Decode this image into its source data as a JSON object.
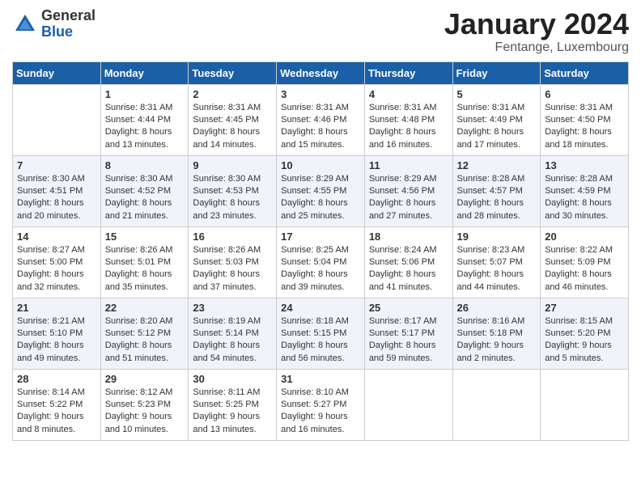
{
  "header": {
    "logo_general": "General",
    "logo_blue": "Blue",
    "month_title": "January 2024",
    "location": "Fentange, Luxembourg"
  },
  "days_of_week": [
    "Sunday",
    "Monday",
    "Tuesday",
    "Wednesday",
    "Thursday",
    "Friday",
    "Saturday"
  ],
  "weeks": [
    [
      {
        "day": "",
        "info": ""
      },
      {
        "day": "1",
        "info": "Sunrise: 8:31 AM\nSunset: 4:44 PM\nDaylight: 8 hours\nand 13 minutes."
      },
      {
        "day": "2",
        "info": "Sunrise: 8:31 AM\nSunset: 4:45 PM\nDaylight: 8 hours\nand 14 minutes."
      },
      {
        "day": "3",
        "info": "Sunrise: 8:31 AM\nSunset: 4:46 PM\nDaylight: 8 hours\nand 15 minutes."
      },
      {
        "day": "4",
        "info": "Sunrise: 8:31 AM\nSunset: 4:48 PM\nDaylight: 8 hours\nand 16 minutes."
      },
      {
        "day": "5",
        "info": "Sunrise: 8:31 AM\nSunset: 4:49 PM\nDaylight: 8 hours\nand 17 minutes."
      },
      {
        "day": "6",
        "info": "Sunrise: 8:31 AM\nSunset: 4:50 PM\nDaylight: 8 hours\nand 18 minutes."
      }
    ],
    [
      {
        "day": "7",
        "info": "Sunrise: 8:30 AM\nSunset: 4:51 PM\nDaylight: 8 hours\nand 20 minutes."
      },
      {
        "day": "8",
        "info": "Sunrise: 8:30 AM\nSunset: 4:52 PM\nDaylight: 8 hours\nand 21 minutes."
      },
      {
        "day": "9",
        "info": "Sunrise: 8:30 AM\nSunset: 4:53 PM\nDaylight: 8 hours\nand 23 minutes."
      },
      {
        "day": "10",
        "info": "Sunrise: 8:29 AM\nSunset: 4:55 PM\nDaylight: 8 hours\nand 25 minutes."
      },
      {
        "day": "11",
        "info": "Sunrise: 8:29 AM\nSunset: 4:56 PM\nDaylight: 8 hours\nand 27 minutes."
      },
      {
        "day": "12",
        "info": "Sunrise: 8:28 AM\nSunset: 4:57 PM\nDaylight: 8 hours\nand 28 minutes."
      },
      {
        "day": "13",
        "info": "Sunrise: 8:28 AM\nSunset: 4:59 PM\nDaylight: 8 hours\nand 30 minutes."
      }
    ],
    [
      {
        "day": "14",
        "info": "Sunrise: 8:27 AM\nSunset: 5:00 PM\nDaylight: 8 hours\nand 32 minutes."
      },
      {
        "day": "15",
        "info": "Sunrise: 8:26 AM\nSunset: 5:01 PM\nDaylight: 8 hours\nand 35 minutes."
      },
      {
        "day": "16",
        "info": "Sunrise: 8:26 AM\nSunset: 5:03 PM\nDaylight: 8 hours\nand 37 minutes."
      },
      {
        "day": "17",
        "info": "Sunrise: 8:25 AM\nSunset: 5:04 PM\nDaylight: 8 hours\nand 39 minutes."
      },
      {
        "day": "18",
        "info": "Sunrise: 8:24 AM\nSunset: 5:06 PM\nDaylight: 8 hours\nand 41 minutes."
      },
      {
        "day": "19",
        "info": "Sunrise: 8:23 AM\nSunset: 5:07 PM\nDaylight: 8 hours\nand 44 minutes."
      },
      {
        "day": "20",
        "info": "Sunrise: 8:22 AM\nSunset: 5:09 PM\nDaylight: 8 hours\nand 46 minutes."
      }
    ],
    [
      {
        "day": "21",
        "info": "Sunrise: 8:21 AM\nSunset: 5:10 PM\nDaylight: 8 hours\nand 49 minutes."
      },
      {
        "day": "22",
        "info": "Sunrise: 8:20 AM\nSunset: 5:12 PM\nDaylight: 8 hours\nand 51 minutes."
      },
      {
        "day": "23",
        "info": "Sunrise: 8:19 AM\nSunset: 5:14 PM\nDaylight: 8 hours\nand 54 minutes."
      },
      {
        "day": "24",
        "info": "Sunrise: 8:18 AM\nSunset: 5:15 PM\nDaylight: 8 hours\nand 56 minutes."
      },
      {
        "day": "25",
        "info": "Sunrise: 8:17 AM\nSunset: 5:17 PM\nDaylight: 8 hours\nand 59 minutes."
      },
      {
        "day": "26",
        "info": "Sunrise: 8:16 AM\nSunset: 5:18 PM\nDaylight: 9 hours\nand 2 minutes."
      },
      {
        "day": "27",
        "info": "Sunrise: 8:15 AM\nSunset: 5:20 PM\nDaylight: 9 hours\nand 5 minutes."
      }
    ],
    [
      {
        "day": "28",
        "info": "Sunrise: 8:14 AM\nSunset: 5:22 PM\nDaylight: 9 hours\nand 8 minutes."
      },
      {
        "day": "29",
        "info": "Sunrise: 8:12 AM\nSunset: 5:23 PM\nDaylight: 9 hours\nand 10 minutes."
      },
      {
        "day": "30",
        "info": "Sunrise: 8:11 AM\nSunset: 5:25 PM\nDaylight: 9 hours\nand 13 minutes."
      },
      {
        "day": "31",
        "info": "Sunrise: 8:10 AM\nSunset: 5:27 PM\nDaylight: 9 hours\nand 16 minutes."
      },
      {
        "day": "",
        "info": ""
      },
      {
        "day": "",
        "info": ""
      },
      {
        "day": "",
        "info": ""
      }
    ]
  ]
}
